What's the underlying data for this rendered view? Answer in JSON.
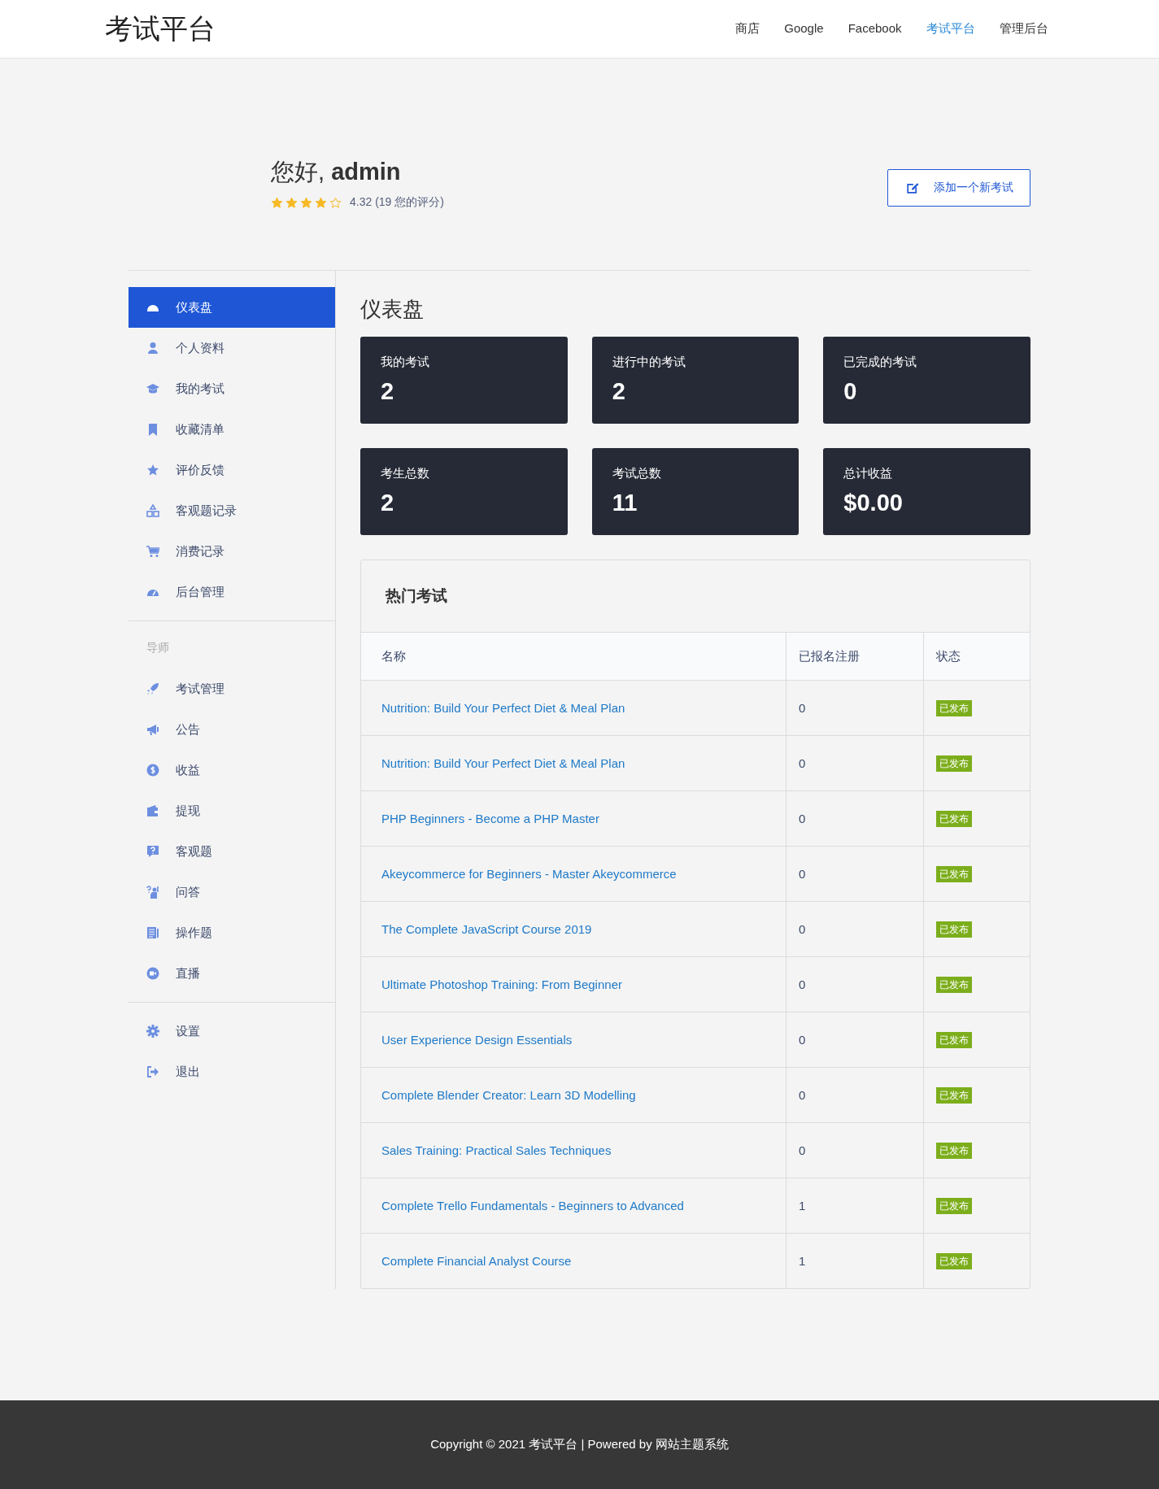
{
  "header": {
    "logo": "考试平台",
    "nav": [
      {
        "label": "商店",
        "selected": false
      },
      {
        "label": "Google",
        "selected": false
      },
      {
        "label": "Facebook",
        "selected": false
      },
      {
        "label": "考试平台",
        "selected": true
      },
      {
        "label": "管理后台",
        "selected": false
      }
    ]
  },
  "profile": {
    "greeting": "您好, **admin**",
    "stars": 4,
    "rating": "4.32 (19 您的评分)",
    "add_button": "添加一个新考试"
  },
  "sidebar": {
    "sections": [
      {
        "items": [
          {
            "label": "仪表盘",
            "selected": true
          },
          {
            "label": "个人资料",
            "selected": false
          },
          {
            "label": "我的考试",
            "selected": false
          },
          {
            "label": "收藏清单",
            "selected": false
          },
          {
            "label": "评价反馈",
            "selected": false
          },
          {
            "label": "客观题记录",
            "selected": false
          },
          {
            "label": "消费记录",
            "selected": false
          },
          {
            "label": "后台管理",
            "selected": false
          }
        ]
      },
      {
        "heading": "导师",
        "items": [
          {
            "label": "考试管理",
            "selected": false
          },
          {
            "label": "公告",
            "selected": false
          },
          {
            "label": "收益",
            "selected": false
          },
          {
            "label": "提现",
            "selected": false
          },
          {
            "label": "客观题",
            "selected": false
          },
          {
            "label": "问答",
            "selected": false
          },
          {
            "label": "操作题",
            "selected": false
          },
          {
            "label": "直播",
            "selected": false
          }
        ]
      },
      {
        "items": [
          {
            "label": "设置",
            "selected": false
          },
          {
            "label": "退出",
            "selected": false
          }
        ]
      }
    ]
  },
  "dashboard": {
    "title": "仪表盘",
    "stats": [
      {
        "label": "我的考试",
        "value": "2"
      },
      {
        "label": "进行中的考试",
        "value": "2"
      },
      {
        "label": "已完成的考试",
        "value": "0"
      },
      {
        "label": "考生总数",
        "value": "2"
      },
      {
        "label": "考试总数",
        "value": "11"
      },
      {
        "label": "总计收益",
        "value": "$0.00"
      }
    ]
  },
  "popular": {
    "title": "热门考试",
    "columns": [
      "名称",
      "已报名注册",
      "状态"
    ],
    "rows": [
      {
        "name": "Nutrition: Build Your Perfect Diet & Meal Plan",
        "enrolled": "0",
        "status": "已发布"
      },
      {
        "name": "Nutrition: Build Your Perfect Diet & Meal Plan",
        "enrolled": "0",
        "status": "已发布"
      },
      {
        "name": "PHP Beginners - Become a PHP Master",
        "enrolled": "0",
        "status": "已发布"
      },
      {
        "name": "Akeycommerce for Beginners - Master Akeycommerce",
        "enrolled": "0",
        "status": "已发布"
      },
      {
        "name": "The Complete JavaScript Course 2019",
        "enrolled": "0",
        "status": "已发布"
      },
      {
        "name": "Ultimate Photoshop Training: From Beginner",
        "enrolled": "0",
        "status": "已发布"
      },
      {
        "name": "User Experience Design Essentials",
        "enrolled": "0",
        "status": "已发布"
      },
      {
        "name": "Complete Blender Creator: Learn 3D Modelling",
        "enrolled": "0",
        "status": "已发布"
      },
      {
        "name": "Sales Training: Practical Sales Techniques",
        "enrolled": "0",
        "status": "已发布"
      },
      {
        "name": "Complete Trello Fundamentals - Beginners to Advanced",
        "enrolled": "1",
        "status": "已发布"
      },
      {
        "name": "Complete Financial Analyst Course",
        "enrolled": "1",
        "status": "已发布"
      }
    ]
  },
  "footer": {
    "text": "Copyright © 2021 考试平台 | Powered by 网站主题系统"
  }
}
